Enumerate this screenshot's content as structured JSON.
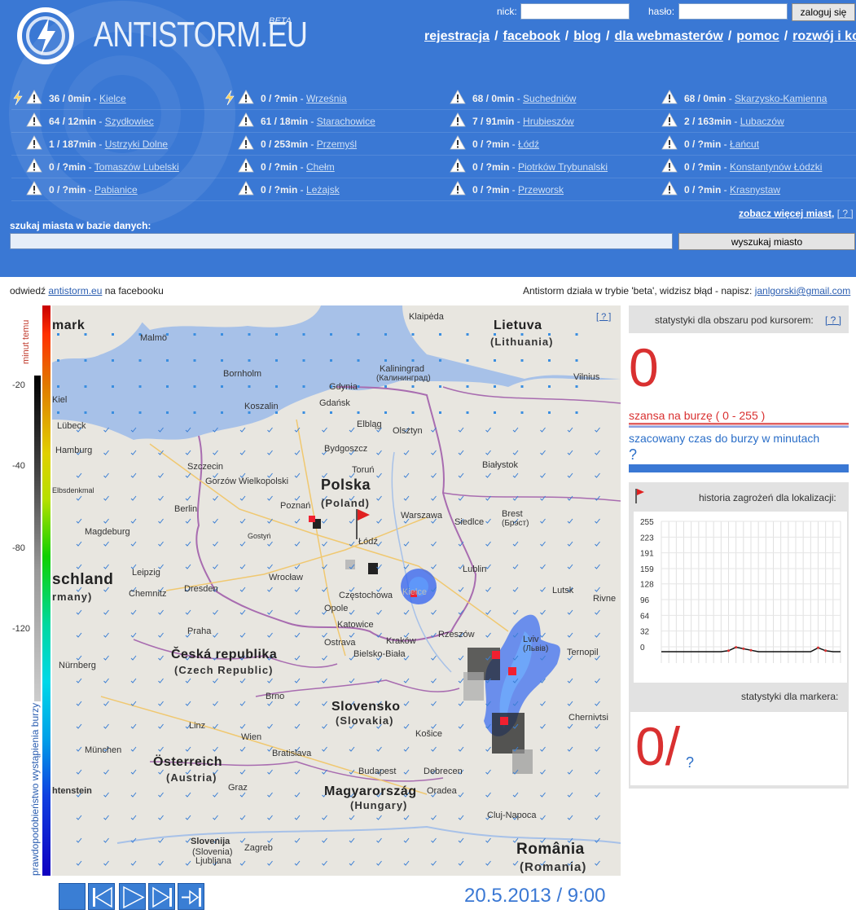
{
  "site": {
    "logo_text": "ANTISTORM.EU",
    "beta": "BETA"
  },
  "login": {
    "nick_label": "nick:",
    "password_label": "hasło:",
    "submit_label": "zaloguj się"
  },
  "nav": {
    "items": [
      {
        "label": "rejestracja"
      },
      {
        "label": "facebook"
      },
      {
        "label": "blog"
      },
      {
        "label": "dla webmasterów"
      },
      {
        "label": "pomoc"
      },
      {
        "label": "rozwój i kontakt"
      }
    ],
    "separator": "/"
  },
  "cities": {
    "rows": [
      [
        {
          "count": "36 / 0min",
          "name": "Kielce",
          "bolt": true
        },
        {
          "count": "0 / ?min",
          "name": "Września",
          "bolt": true
        },
        {
          "count": "68 / 0min",
          "name": "Suchedniów",
          "bolt": false
        },
        {
          "count": "68 / 0min",
          "name": "Skarzysko-Kamienna",
          "bolt": false
        }
      ],
      [
        {
          "count": "64 / 12min",
          "name": "Szydłowiec",
          "bolt": false
        },
        {
          "count": "61 / 18min",
          "name": "Starachowice",
          "bolt": false
        },
        {
          "count": "7 / 91min",
          "name": "Hrubieszów",
          "bolt": false
        },
        {
          "count": "2 / 163min",
          "name": "Lubaczów",
          "bolt": false
        }
      ],
      [
        {
          "count": "1 / 187min",
          "name": "Ustrzyki Dolne",
          "bolt": false
        },
        {
          "count": "0 / 253min",
          "name": "Przemyśl",
          "bolt": false
        },
        {
          "count": "0 / ?min",
          "name": "Łódź",
          "bolt": false
        },
        {
          "count": "0 / ?min",
          "name": "Łańcut",
          "bolt": false
        }
      ],
      [
        {
          "count": "0 / ?min",
          "name": "Tomaszów Lubelski",
          "bolt": false
        },
        {
          "count": "0 / ?min",
          "name": "Chełm",
          "bolt": false
        },
        {
          "count": "0 / ?min",
          "name": "Piotrków Trybunalski",
          "bolt": false
        },
        {
          "count": "0 / ?min",
          "name": "Konstantynów Łódzki",
          "bolt": false
        }
      ],
      [
        {
          "count": "0 / ?min",
          "name": "Pabianice",
          "bolt": false
        },
        {
          "count": "0 / ?min",
          "name": "Leżajsk",
          "bolt": false
        },
        {
          "count": "0 / ?min",
          "name": "Przeworsk",
          "bolt": false
        },
        {
          "count": "0 / ?min",
          "name": "Krasnystaw",
          "bolt": false
        }
      ]
    ],
    "more_link": "zobacz więcej miast",
    "more_help": "[ ? ]"
  },
  "search": {
    "label": "szukaj miasta w bazie danych:",
    "button": "wyszukaj miasto",
    "value": ""
  },
  "info": {
    "left_prefix": "odwiedź ",
    "left_link": "antistorm.eu",
    "left_suffix": " na facebooku",
    "right_text": "Antistorm działa w trybie 'beta', widzisz błąd - napisz: ",
    "right_email": "janlgorski@gmail.com"
  },
  "legend": {
    "title": "minut temu",
    "ticks": [
      "-20",
      "-40",
      "-80",
      "-120"
    ],
    "probability_label": "prawdopodobieństwo wystąpienia burzy"
  },
  "map": {
    "help": "[ ? ]",
    "labels": {
      "denmark": "mark",
      "lietuva": "Lietuva",
      "lithuania": "(Lithuania)",
      "polska": "Polska",
      "poland": "(Poland)",
      "deutschland": "schland",
      "germany": "rmany)",
      "cesko": "Česká republika",
      "czech": "(Czech Republic)",
      "slovensko": "Slovensko",
      "slovakia": "(Slovakia)",
      "osterreich": "Österreich",
      "austria": "(Austria)",
      "magyar": "Magyarország",
      "hungary": "(Hungary)",
      "romania": "România",
      "romania2": "(Romania)",
      "liechtenstein": "htenstein",
      "slovenija": "Slovenija",
      "slovenia": "(Slovenia)"
    },
    "cities": [
      "Klaipėda",
      "Bornholm",
      "Malmö",
      "Gdynia",
      "Gdańsk",
      "Koszalin",
      "Kaliningrad",
      "(Калининград)",
      "Elbląg",
      "Olsztyn",
      "Kiel",
      "Lübeck",
      "Hamburg",
      "Szczecin",
      "Gorzów Wielkopolski",
      "Berlin",
      "Poznań",
      "Bydgoszcz",
      "Toruń",
      "Warszawa",
      "Białystok",
      "Siedlce",
      "Brest",
      "(Брэст)",
      "Łódź",
      "Lublin",
      "Wrocław",
      "Częstochowa",
      "Kielce",
      "Opole",
      "Katowice",
      "Kraków",
      "Rzeszów",
      "Lviv",
      "(Львів)",
      "Ternopil",
      "Magdeburg",
      "Leipzig",
      "Dresden",
      "Chemnitz",
      "Praha",
      "Ostrava",
      "Bielsko-Biała",
      "Brno",
      "Nürnberg",
      "Linz",
      "Wien",
      "Bratislava",
      "Košice",
      "Debrecen",
      "Budapest",
      "München",
      "Graz",
      "Cluj-Napoca",
      "Oradea",
      "Zagreb",
      "Ljubljana",
      "Chernivtsi",
      "Rivne",
      "Lutsk",
      "Vilnius",
      "Elbsdenkmal",
      "Gostyń"
    ]
  },
  "playback": {
    "buttons": [
      "stop",
      "step-back",
      "play",
      "step-forward",
      "skip-to-end"
    ],
    "timestamp": "20.5.2013 / 9:00"
  },
  "stats": {
    "header": "statystyki dla obszaru pod kursorem:",
    "help": "[ ? ]",
    "chance_value": "0",
    "chance_label": "szansa na burzę ( 0 - 255 )",
    "eta_label": "szacowany czas do burzy w minutach",
    "eta_value": "?",
    "history_label": "historia zagrożeń dla lokalizacji:",
    "marker_label": "statystyki dla markera:",
    "marker_value": "0/",
    "marker_q": "?"
  },
  "chart_data": {
    "type": "line",
    "title": "",
    "ylim": [
      0,
      255
    ],
    "yticks": [
      0,
      32,
      64,
      96,
      128,
      159,
      191,
      223,
      255
    ],
    "x": [
      0,
      1,
      2,
      3,
      4,
      5,
      6,
      7,
      8,
      9,
      10,
      11,
      12,
      13,
      14,
      15,
      16,
      17,
      18,
      19,
      20,
      21,
      22,
      23,
      24
    ],
    "series": [
      {
        "values": [
          0,
          0,
          0,
          0,
          0,
          0,
          0,
          0,
          0,
          2,
          9,
          6,
          3,
          0,
          0,
          0,
          0,
          0,
          0,
          0,
          0,
          8,
          2,
          0,
          0
        ]
      }
    ]
  },
  "colors": {
    "header_bg": "#3a78d4",
    "accent_red": "#d93030",
    "accent_blue": "#2a6ec8"
  }
}
